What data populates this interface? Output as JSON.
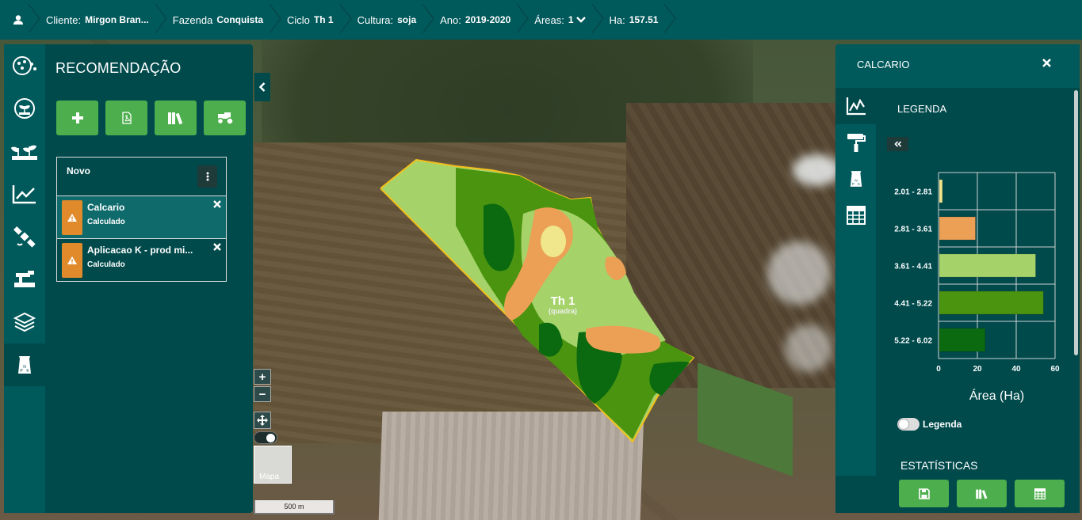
{
  "topbar": {
    "crumbs": [
      {
        "key": "Cliente:",
        "value": "Mirgon Bran..."
      },
      {
        "key": "Fazenda",
        "value": "Conquista"
      },
      {
        "key": "Ciclo",
        "value": "Th 1"
      },
      {
        "key": "Cultura:",
        "value": "soja"
      },
      {
        "key": "Ano:",
        "value": "2019-2020"
      },
      {
        "key": "Áreas:",
        "value": "1"
      },
      {
        "key": "Ha:",
        "value": "157.51"
      }
    ]
  },
  "left_panel": {
    "title": "RECOMENDAÇÃO",
    "list_header": "Novo",
    "items": [
      {
        "name": "Calcario",
        "status": "Calculado"
      },
      {
        "name": "Aplicacao K - prod mi...",
        "status": "Calculado"
      }
    ]
  },
  "map": {
    "field_label": "Th 1",
    "field_sublabel": "(quadra)",
    "thumb_label": "Mapa",
    "scale_label": "500 m"
  },
  "right_panel": {
    "title": "CALCARIO",
    "legend_title": "LEGENDA",
    "legend_toggle_label": "Legenda",
    "stats_title": "ESTATÍSTICAS"
  },
  "colors": {
    "class1": "#f0e68c",
    "class2": "#eba055",
    "class3": "#a5d36a",
    "class4": "#4a9410",
    "class5": "#0b6a10"
  },
  "chart_data": {
    "type": "bar",
    "orientation": "horizontal",
    "categories": [
      "2.01 - 2.81",
      "2.81 - 3.61",
      "3.61 - 4.41",
      "4.41 - 5.22",
      "5.22 - 6.02"
    ],
    "values": [
      2,
      19,
      50,
      54,
      24
    ],
    "xlabel": "Área (Ha)",
    "ylabel": "",
    "xlim": [
      0,
      60
    ],
    "xticks": [
      0,
      20,
      40,
      60
    ],
    "grid": true
  }
}
